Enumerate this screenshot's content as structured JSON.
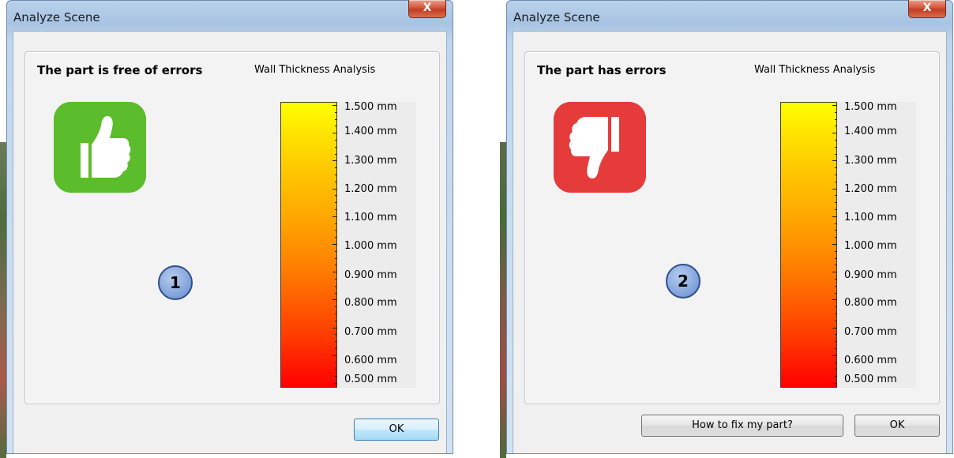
{
  "scale_labels": [
    "1.500 mm",
    "1.400 mm",
    "1.300 mm",
    "1.200 mm",
    "1.100 mm",
    "1.000 mm",
    "0.900 mm",
    "0.800 mm",
    "0.700 mm",
    "0.600 mm",
    "0.500 mm"
  ],
  "dialog1": {
    "title": "Analyze Scene",
    "close_glyph": "X",
    "status": "The part is free of errors",
    "analysis_label": "Wall Thickness Analysis",
    "icon": "thumbs-up-icon",
    "icon_color": "#5bbd2b",
    "badge": "1",
    "ok_label": "OK"
  },
  "dialog2": {
    "title": "Analyze Scene",
    "close_glyph": "X",
    "status": "The part has errors",
    "analysis_label": "Wall Thickness Analysis",
    "icon": "thumbs-down-icon",
    "icon_color": "#e53b3b",
    "badge": "2",
    "fix_label": "How to fix my part?",
    "ok_label": "OK"
  }
}
